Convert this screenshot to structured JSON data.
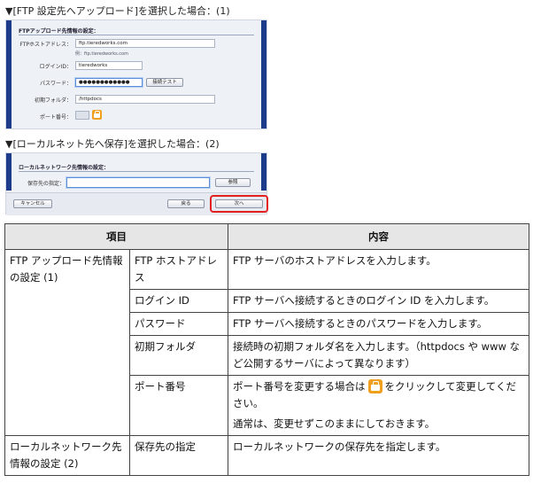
{
  "captions": {
    "ftp": "▼[FTP 設定先へアップロード]を選択した場合：(1)",
    "local": "▼[ローカルネット先へ保存]を選択した場合：(2)"
  },
  "ftp_dialog": {
    "section_title": "FTPアップロード先情報の設定：",
    "host_label": "FTPホストアドレス：",
    "host_value": "ftp.tieredworks.com",
    "host_hint": "例：ftp.tieredworks.com",
    "login_label": "ログインID：",
    "login_value": "tieredworks",
    "password_label": "パスワード：",
    "password_value": "●●●●●●●●●●●●",
    "connect_test_label": "接続テスト",
    "folder_label": "初期フォルダ：",
    "folder_value": "/httpdocs",
    "port_label": "ポート番号："
  },
  "local_dialog": {
    "section_title": "ローカルネットワーク先情報の設定：",
    "save_label": "保存先の指定：",
    "browse_label": "参照",
    "cancel_label": "キャンセル",
    "back_label": "戻る",
    "next_label": "次へ"
  },
  "table": {
    "headers": [
      "項目",
      "内容"
    ],
    "group1": "FTP アップロード先情報の設定 (1)",
    "group2": "ローカルネットワーク先情報の設定 (2)",
    "rows": [
      {
        "item": "FTP ホストアドレス",
        "desc": "FTP サーバのホストアドレスを入力します。"
      },
      {
        "item": "ログイン ID",
        "desc": "FTP サーバへ接続するときのログイン ID を入力します。"
      },
      {
        "item": "パスワード",
        "desc": "FTP サーバへ接続するときのパスワードを入力します。"
      },
      {
        "item": "初期フォルダ",
        "desc": "接続時の初期フォルダ名を入力します。（httpdocs や www など公開するサーバによって異なります）"
      },
      {
        "item": "ポート番号",
        "desc_pre": "ポート番号を変更する場合は",
        "desc_post": "をクリックして変更してください。",
        "desc_note": "通常は、変更せずこのままにしておきます。"
      },
      {
        "item": "保存先の指定",
        "desc": "ローカルネットワークの保存先を指定します。"
      }
    ]
  },
  "icons": {
    "lock": "lock-icon"
  },
  "colors": {
    "accent_blue": "#1c3b8a",
    "highlight_red": "#e32020",
    "lock_orange": "#f0a020"
  }
}
